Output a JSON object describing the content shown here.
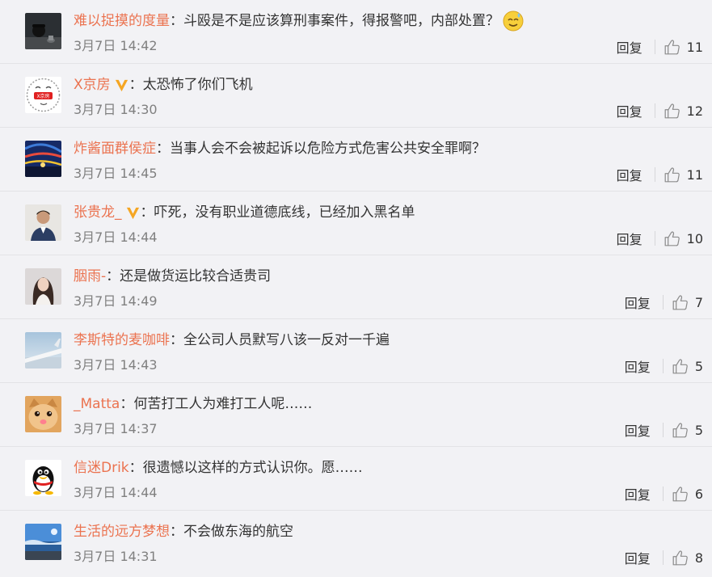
{
  "ui": {
    "reply_label": "回复"
  },
  "colors": {
    "username": "#eb7350",
    "text": "#333333",
    "time": "#808080",
    "badge": "#f5a623",
    "divider": "#e3e3e6",
    "background": "#f2f2f5"
  },
  "comments": [
    {
      "user": "难以捉摸的度量",
      "verified": false,
      "text": "：斗殴是不是应该算刑事案件，得报警吧，内部处置？",
      "emoji": "sweat-smile-emoji",
      "time": "3月7日 14:42",
      "likes": "11",
      "avatar": "dark-figure"
    },
    {
      "user": "X京房",
      "verified": true,
      "text": "：太恐怖了你们飞机",
      "time": "3月7日 14:30",
      "likes": "12",
      "avatar": "logo",
      "avatar_text": "X京房"
    },
    {
      "user": "炸酱面群侯症",
      "verified": false,
      "text": "：当事人会不会被起诉以危险方式危害公共安全罪啊？",
      "time": "3月7日 14:45",
      "likes": "11",
      "avatar": "colorful-night"
    },
    {
      "user": "张贵龙_",
      "verified": true,
      "text": "：吓死，没有职业道德底线，已经加入黑名单",
      "time": "3月7日 14:44",
      "likes": "10",
      "avatar": "man-portrait"
    },
    {
      "user": "胭雨-",
      "verified": false,
      "text": "：还是做货运比较合适贵司",
      "time": "3月7日 14:49",
      "likes": "7",
      "avatar": "woman-portrait"
    },
    {
      "user": "李斯特的麦咖啡",
      "verified": false,
      "text": "：全公司人员默写八该一反对一千遍",
      "time": "3月7日 14:43",
      "likes": "5",
      "avatar": "airplane-wing"
    },
    {
      "user": "_Matta",
      "verified": false,
      "text": "：何苦打工人为难打工人呢……",
      "time": "3月7日 14:37",
      "likes": "5",
      "avatar": "cat"
    },
    {
      "user": "信迷Drik",
      "verified": false,
      "text": "：很遗憾以这样的方式认识你。愿……",
      "time": "3月7日 14:44",
      "likes": "6",
      "avatar": "penguin"
    },
    {
      "user": "生活的远方梦想",
      "verified": false,
      "text": "：不会做东海的航空",
      "time": "3月7日 14:31",
      "likes": "8",
      "avatar": "blue-landscape"
    }
  ]
}
